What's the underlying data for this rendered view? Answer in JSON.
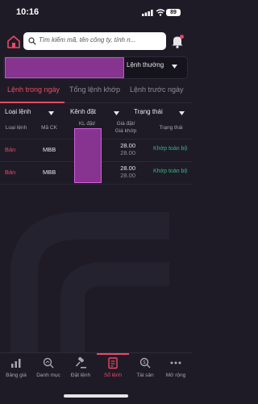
{
  "status_bar": {
    "time": "10:16",
    "battery": "89"
  },
  "header": {
    "search_placeholder": "Tìm kiếm mã, tên công ty, tính n..."
  },
  "account": {
    "order_type": "Lệnh thường"
  },
  "tabs": [
    {
      "label": "Lệnh trong ngày",
      "active": true
    },
    {
      "label": "Tổng lệnh khớp",
      "active": false
    },
    {
      "label": "Lệnh trước ngày",
      "active": false
    }
  ],
  "filters": [
    {
      "label": "Loại lệnh"
    },
    {
      "label": "Kênh đặt"
    },
    {
      "label": "Trạng thái"
    }
  ],
  "table": {
    "headers": {
      "type": "Loại lệnh",
      "symbol": "Mã CK",
      "qty": "KL đặt/",
      "price_line1": "Giá đặt/",
      "price_line2": "Giá khớp",
      "status": "Trạng thái"
    },
    "rows": [
      {
        "side": "Bán",
        "symbol": "MBB",
        "order_price": "28.00",
        "match_price": "28.00",
        "status": "Khớp toàn bộ"
      },
      {
        "side": "Bán",
        "symbol": "MBB",
        "order_price": "28.00",
        "match_price": "28.00",
        "status": "Khớp toàn bộ"
      }
    ]
  },
  "bottom_nav": [
    {
      "label": "Bảng giá",
      "icon": "price-board-icon"
    },
    {
      "label": "Danh mục",
      "icon": "portfolio-icon"
    },
    {
      "label": "Đặt lệnh",
      "icon": "gavel-icon"
    },
    {
      "label": "Sổ lệnh",
      "icon": "order-book-icon",
      "active": true
    },
    {
      "label": "Tài sản",
      "icon": "assets-icon"
    },
    {
      "label": "Mở rộng",
      "icon": "more-icon"
    }
  ],
  "colors": {
    "background": "#1e1b27",
    "accent": "#e74c64",
    "sell": "#e74c64",
    "matched": "#39b586",
    "redaction": "#86348f"
  }
}
